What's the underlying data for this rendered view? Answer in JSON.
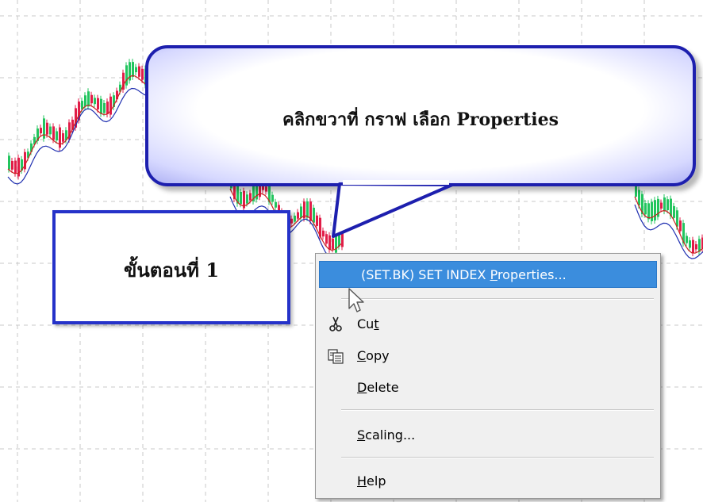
{
  "callout": {
    "text": "คลิกขวาที่ กราฟ เลือก Properties"
  },
  "step": {
    "label": "ขั้นตอนที่ 1"
  },
  "context_menu": {
    "items": [
      {
        "pre": "(SET.BK) SET INDEX ",
        "accel": "P",
        "post": "roperties...",
        "highlighted": true
      },
      {
        "pre": "Cu",
        "accel": "t",
        "post": "",
        "icon": "scissors-icon"
      },
      {
        "pre": "",
        "accel": "C",
        "post": "opy",
        "icon": "copy-icon"
      },
      {
        "pre": "",
        "accel": "D",
        "post": "elete"
      },
      {
        "pre": "",
        "accel": "S",
        "post": "caling..."
      },
      {
        "pre": "",
        "accel": "H",
        "post": "elp"
      }
    ]
  },
  "colors": {
    "callout_border": "#1d1fae",
    "step_border": "#2532c9",
    "menu_highlight": "#3b8ddd",
    "candle_up": "#22c55e",
    "candle_down": "#e11d48",
    "ma_blue": "#1f2fb0",
    "ma_red": "#cc1f1f"
  }
}
